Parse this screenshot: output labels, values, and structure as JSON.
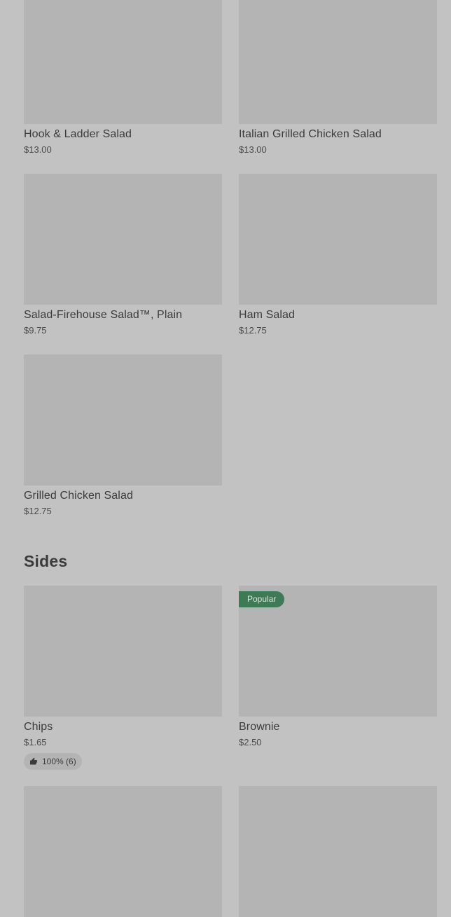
{
  "salads": [
    {
      "name": "Hook & Ladder Salad",
      "price": "$13.00"
    },
    {
      "name": "Italian Grilled Chicken Salad",
      "price": "$13.00"
    },
    {
      "name": "Salad-Firehouse Salad™, Plain",
      "price": "$9.75"
    },
    {
      "name": "Ham Salad",
      "price": "$12.75"
    },
    {
      "name": "Grilled Chicken Salad",
      "price": "$12.75"
    }
  ],
  "sides": {
    "title": "Sides",
    "items": [
      {
        "name": "Chips",
        "price": "$1.65",
        "rating": "100% (6)"
      },
      {
        "name": "Brownie",
        "price": "$2.50",
        "badge": "Popular"
      }
    ]
  },
  "colors": {
    "background": "#c2c2c2",
    "image_placeholder": "#b4b4b4",
    "popular_badge": "#3e7a55"
  }
}
